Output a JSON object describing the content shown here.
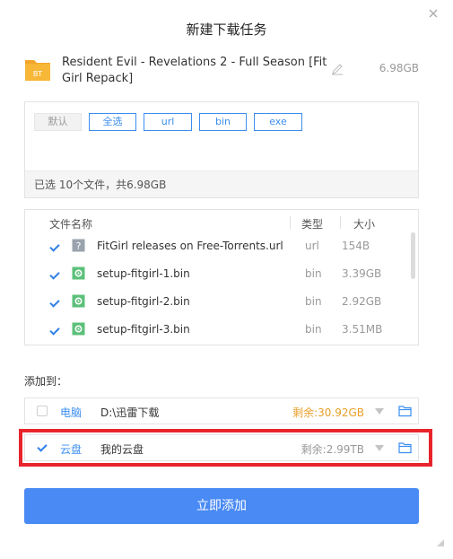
{
  "dialog": {
    "title": "新建下载任务"
  },
  "task": {
    "icon_label": "BT",
    "name": "Resident Evil - Revelations 2 - Full Season [FitGirl Repack]",
    "size": "6.98GB"
  },
  "filters": {
    "tags": [
      "默认",
      "全选",
      "url",
      "bin",
      "exe"
    ],
    "selected_summary": "已选 10个文件，共6.98GB"
  },
  "files": {
    "headers": {
      "name": "文件名称",
      "type": "类型",
      "size": "大小"
    },
    "rows": [
      {
        "name": "FitGirl releases on Free-Torrents.url",
        "type": "url",
        "size": "154B",
        "icon": "question-file-icon",
        "checked": true
      },
      {
        "name": "setup-fitgirl-1.bin",
        "type": "bin",
        "size": "3.39GB",
        "icon": "gear-file-icon",
        "checked": true
      },
      {
        "name": "setup-fitgirl-2.bin",
        "type": "bin",
        "size": "2.92GB",
        "icon": "gear-file-icon",
        "checked": true
      },
      {
        "name": "setup-fitgirl-3.bin",
        "type": "bin",
        "size": "3.51MB",
        "icon": "gear-file-icon",
        "checked": true
      }
    ]
  },
  "destination": {
    "label": "添加到：",
    "options": [
      {
        "name": "电脑",
        "path": "D:\\迅雷下载",
        "free": "剩余:30.92GB",
        "checked": false
      },
      {
        "name": "云盘",
        "path": "我的云盘",
        "free": "剩余:2.99TB",
        "checked": true
      }
    ]
  },
  "actions": {
    "submit_label": "立即添加"
  },
  "colors": {
    "accent": "#4a8af4",
    "highlight": "#e8242c",
    "warning": "#e8a02a"
  }
}
